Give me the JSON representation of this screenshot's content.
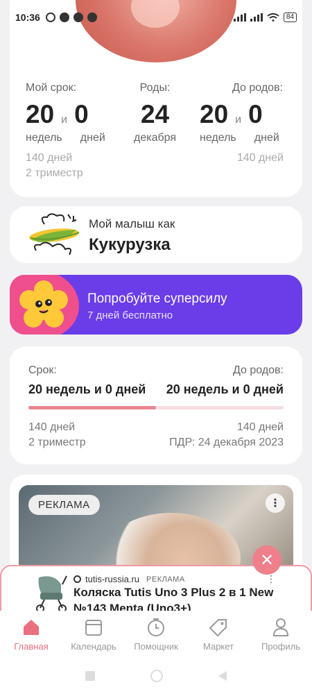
{
  "status_bar": {
    "time": "10:36",
    "battery": "84"
  },
  "pregnancy": {
    "my_term": {
      "label": "Мой срок:",
      "weeks": "20",
      "and": "и",
      "days": "0",
      "weeks_unit": "недель",
      "days_unit": "дней"
    },
    "birth": {
      "label": "Роды:",
      "day": "24",
      "month": "декабря"
    },
    "until_birth": {
      "label": "До родов:",
      "weeks": "20",
      "and": "и",
      "days": "0",
      "weeks_unit": "недель",
      "days_unit": "дней"
    },
    "left_sub1": "140 дней",
    "left_sub2": "2 триместр",
    "right_sub1": "140 дней"
  },
  "baby": {
    "prefix": "Мой малыш как",
    "name": "Кукурузка"
  },
  "promo": {
    "title": "Попробуйте суперсилу",
    "subtitle": "7 дней бесплатно"
  },
  "progress": {
    "term_label": "Срок:",
    "term_value": "20 недель и 0 дней",
    "remaining_label": "До родов:",
    "remaining_value": "20 недель и 0 дней",
    "progress_fraction": 0.5,
    "left_days": "140 дней",
    "trimester": "2 триместр",
    "right_days": "140 дней",
    "due_date": "ПДР: 24 декабря 2023"
  },
  "ad": {
    "badge": "РЕКЛАМА",
    "more": "⋮",
    "close": "✕",
    "banner_domain": "tutis-russia.ru",
    "banner_label": "РЕКЛАМА",
    "banner_title": "Коляска Tutis Uno 3 Plus 2 в 1 New №143 Menta (Uno3+)",
    "banner_more": "⋮"
  },
  "tabs": [
    {
      "label": "Главная",
      "icon": "home-icon",
      "active": true
    },
    {
      "label": "Календарь",
      "icon": "calendar-icon",
      "active": false
    },
    {
      "label": "Помощник",
      "icon": "clock-icon",
      "active": false
    },
    {
      "label": "Маркет",
      "icon": "tag-icon",
      "active": false
    },
    {
      "label": "Профиль",
      "icon": "profile-icon",
      "active": false
    }
  ],
  "colors": {
    "accent": "#e9707d",
    "promo": "#6a3de8",
    "promo_blob": "#ef4f8c",
    "progress_fill": "#e98690"
  }
}
